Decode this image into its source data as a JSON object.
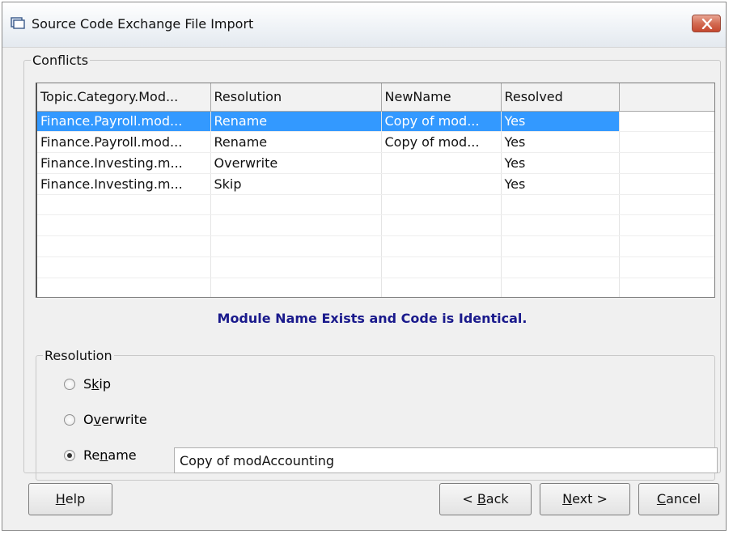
{
  "window": {
    "title": "Source Code Exchange File Import"
  },
  "conflicts": {
    "legend": "Conflicts",
    "columns": [
      "Topic.Category.Mod...",
      "Resolution",
      "NewName",
      "Resolved",
      ""
    ],
    "rows": [
      {
        "topic": "Finance.Payroll.mod...",
        "resolution": "Rename",
        "newname": "Copy of mod...",
        "resolved": "Yes",
        "selected": true
      },
      {
        "topic": "Finance.Payroll.mod...",
        "resolution": "Rename",
        "newname": "Copy of mod...",
        "resolved": "Yes"
      },
      {
        "topic": "Finance.Investing.m...",
        "resolution": "Overwrite",
        "newname": "",
        "resolved": "Yes"
      },
      {
        "topic": "Finance.Investing.m...",
        "resolution": "Skip",
        "newname": "",
        "resolved": "Yes"
      },
      {
        "topic": "",
        "resolution": "",
        "newname": "",
        "resolved": ""
      },
      {
        "topic": "",
        "resolution": "",
        "newname": "",
        "resolved": ""
      },
      {
        "topic": "",
        "resolution": "",
        "newname": "",
        "resolved": ""
      },
      {
        "topic": "",
        "resolution": "",
        "newname": "",
        "resolved": ""
      },
      {
        "topic": "",
        "resolution": "",
        "newname": "",
        "resolved": ""
      }
    ],
    "message": "Module Name Exists and Code is Identical."
  },
  "resolution": {
    "legend": "Resolution",
    "skip": {
      "pre": "S",
      "key": "k",
      "post": "ip"
    },
    "overwrite": {
      "pre": "O",
      "key": "v",
      "post": "erwrite"
    },
    "rename": {
      "pre": "Re",
      "key": "n",
      "post": "ame"
    },
    "selected": "Rename",
    "rename_value": "Copy of modAccounting"
  },
  "buttons": {
    "help": {
      "key": "H",
      "rest": "elp"
    },
    "back": {
      "pre": "< ",
      "key": "B",
      "rest": "ack"
    },
    "next": {
      "key": "N",
      "rest": "ext >"
    },
    "cancel": {
      "key": "C",
      "rest": "ancel"
    }
  },
  "colors": {
    "selection": "#3399ff",
    "message": "#1a1a8c",
    "close": "#c5482f"
  }
}
